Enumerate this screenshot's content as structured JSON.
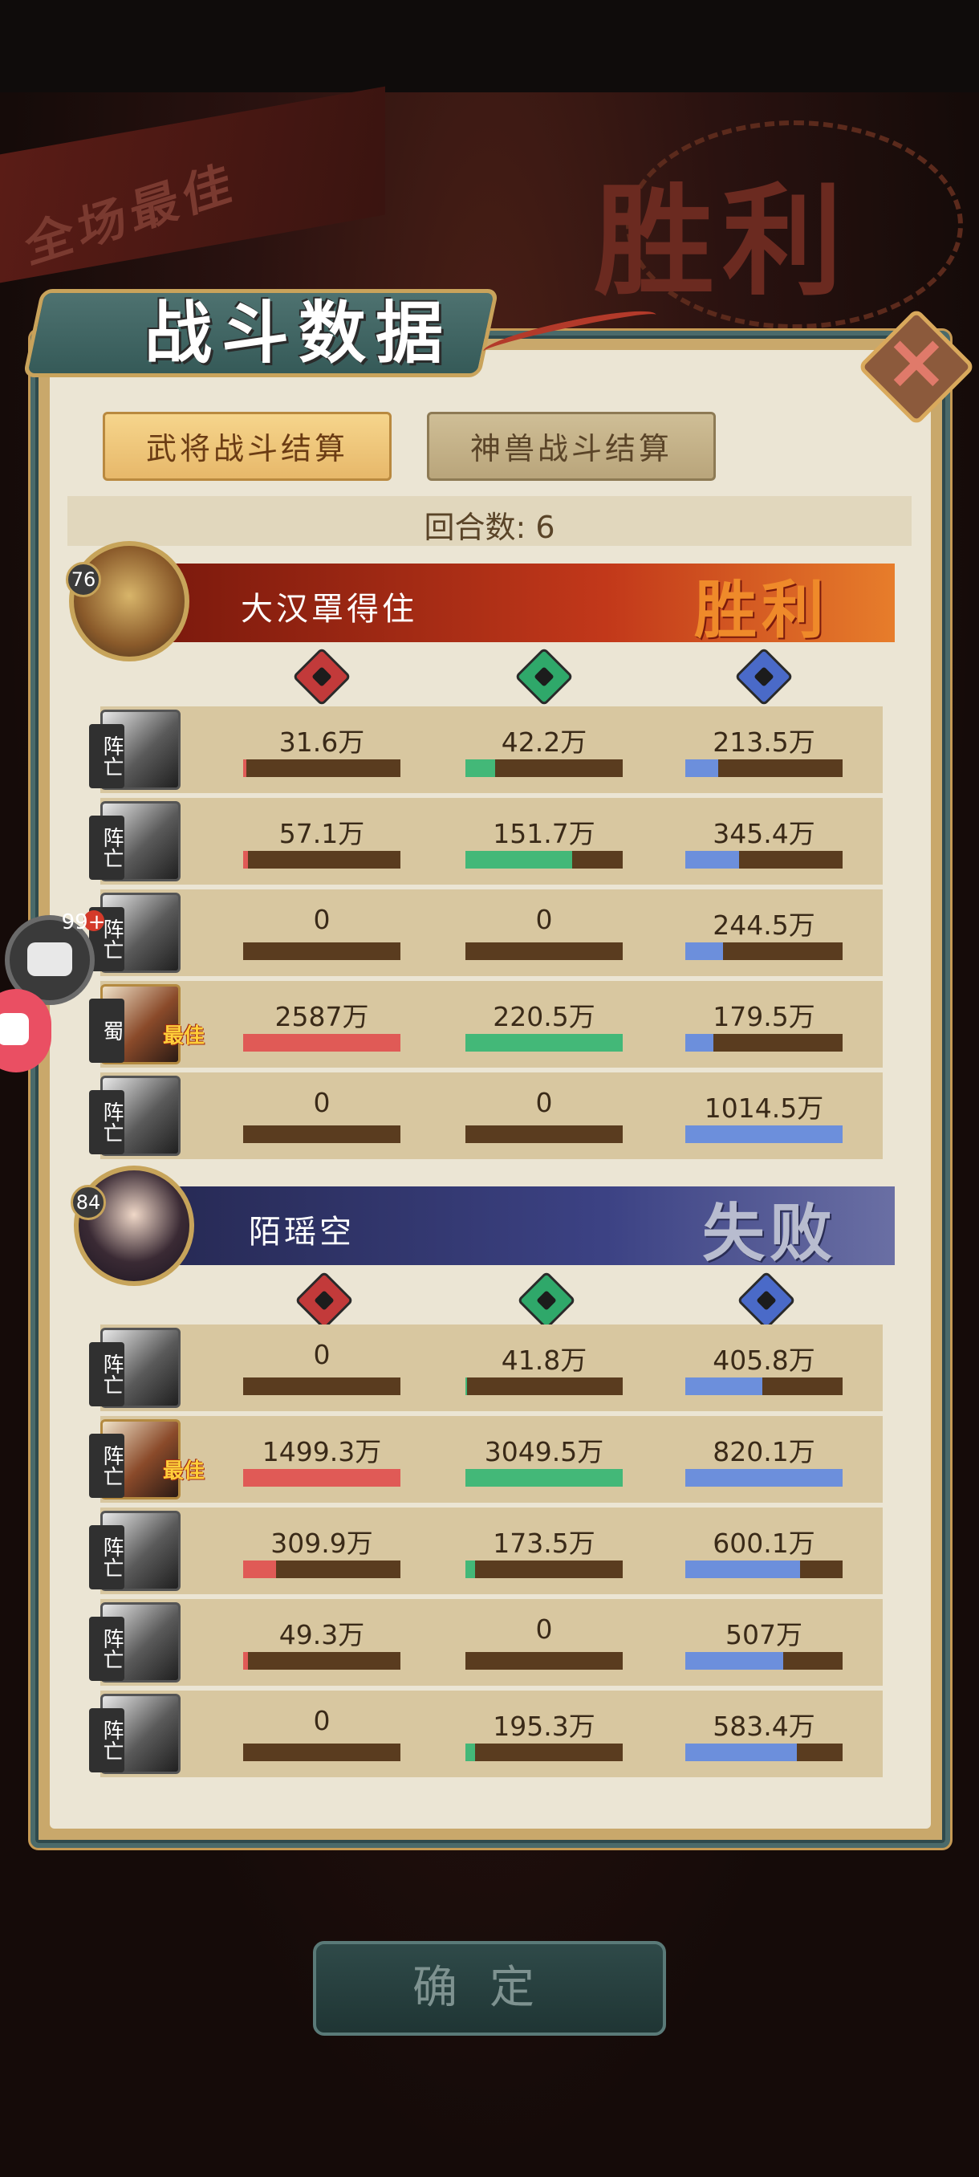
{
  "background": {
    "banner_text": "全场最佳",
    "victory_text": "胜利"
  },
  "header": {
    "title": "战斗数据"
  },
  "tabs": [
    {
      "label": "武将战斗结算",
      "active": true
    },
    {
      "label": "神兽战斗结算",
      "active": false
    }
  ],
  "rounds_label": "回合数: 6",
  "colors": {
    "damage": "#e05a56",
    "heal": "#43b878",
    "defense": "#6c8fdc",
    "bar_bg": "#5a3c1f"
  },
  "teams": [
    {
      "name": "大汉罩得住",
      "level": "76",
      "result": "胜利",
      "heroes": [
        {
          "tag": "阵亡",
          "damage": "31.6万",
          "heal": "42.2万",
          "defense": "213.5万",
          "damage_fill": 0.02,
          "heal_fill": 0.19,
          "defense_fill": 0.21
        },
        {
          "tag": "阵亡",
          "damage": "57.1万",
          "heal": "151.7万",
          "defense": "345.4万",
          "damage_fill": 0.03,
          "heal_fill": 0.68,
          "defense_fill": 0.34
        },
        {
          "tag": "阵亡",
          "damage": "0",
          "heal": "0",
          "defense": "244.5万",
          "damage_fill": 0,
          "heal_fill": 0,
          "defense_fill": 0.24
        },
        {
          "tag": "蜀",
          "mvp": "最佳",
          "damage": "2587万",
          "heal": "220.5万",
          "defense": "179.5万",
          "damage_fill": 1.0,
          "heal_fill": 1.0,
          "defense_fill": 0.18
        },
        {
          "tag": "阵亡",
          "damage": "0",
          "heal": "0",
          "defense": "1014.5万",
          "damage_fill": 0,
          "heal_fill": 0,
          "defense_fill": 1.0
        }
      ]
    },
    {
      "name": "陌瑶空",
      "level": "84",
      "result": "失败",
      "heroes": [
        {
          "tag": "阵亡",
          "damage": "0",
          "heal": "41.8万",
          "defense": "405.8万",
          "damage_fill": 0,
          "heal_fill": 0.01,
          "defense_fill": 0.49
        },
        {
          "tag": "阵亡",
          "mvp": "最佳",
          "damage": "1499.3万",
          "heal": "3049.5万",
          "defense": "820.1万",
          "damage_fill": 1.0,
          "heal_fill": 1.0,
          "defense_fill": 1.0
        },
        {
          "tag": "阵亡",
          "damage": "309.9万",
          "heal": "173.5万",
          "defense": "600.1万",
          "damage_fill": 0.21,
          "heal_fill": 0.06,
          "defense_fill": 0.73
        },
        {
          "tag": "阵亡",
          "damage": "49.3万",
          "heal": "0",
          "defense": "507万",
          "damage_fill": 0.03,
          "heal_fill": 0,
          "defense_fill": 0.62
        },
        {
          "tag": "阵亡",
          "damage": "0",
          "heal": "195.3万",
          "defense": "583.4万",
          "damage_fill": 0,
          "heal_fill": 0.06,
          "defense_fill": 0.71
        }
      ]
    }
  ],
  "confirm_label": "确定",
  "floating": {
    "chat_count": "99+"
  }
}
